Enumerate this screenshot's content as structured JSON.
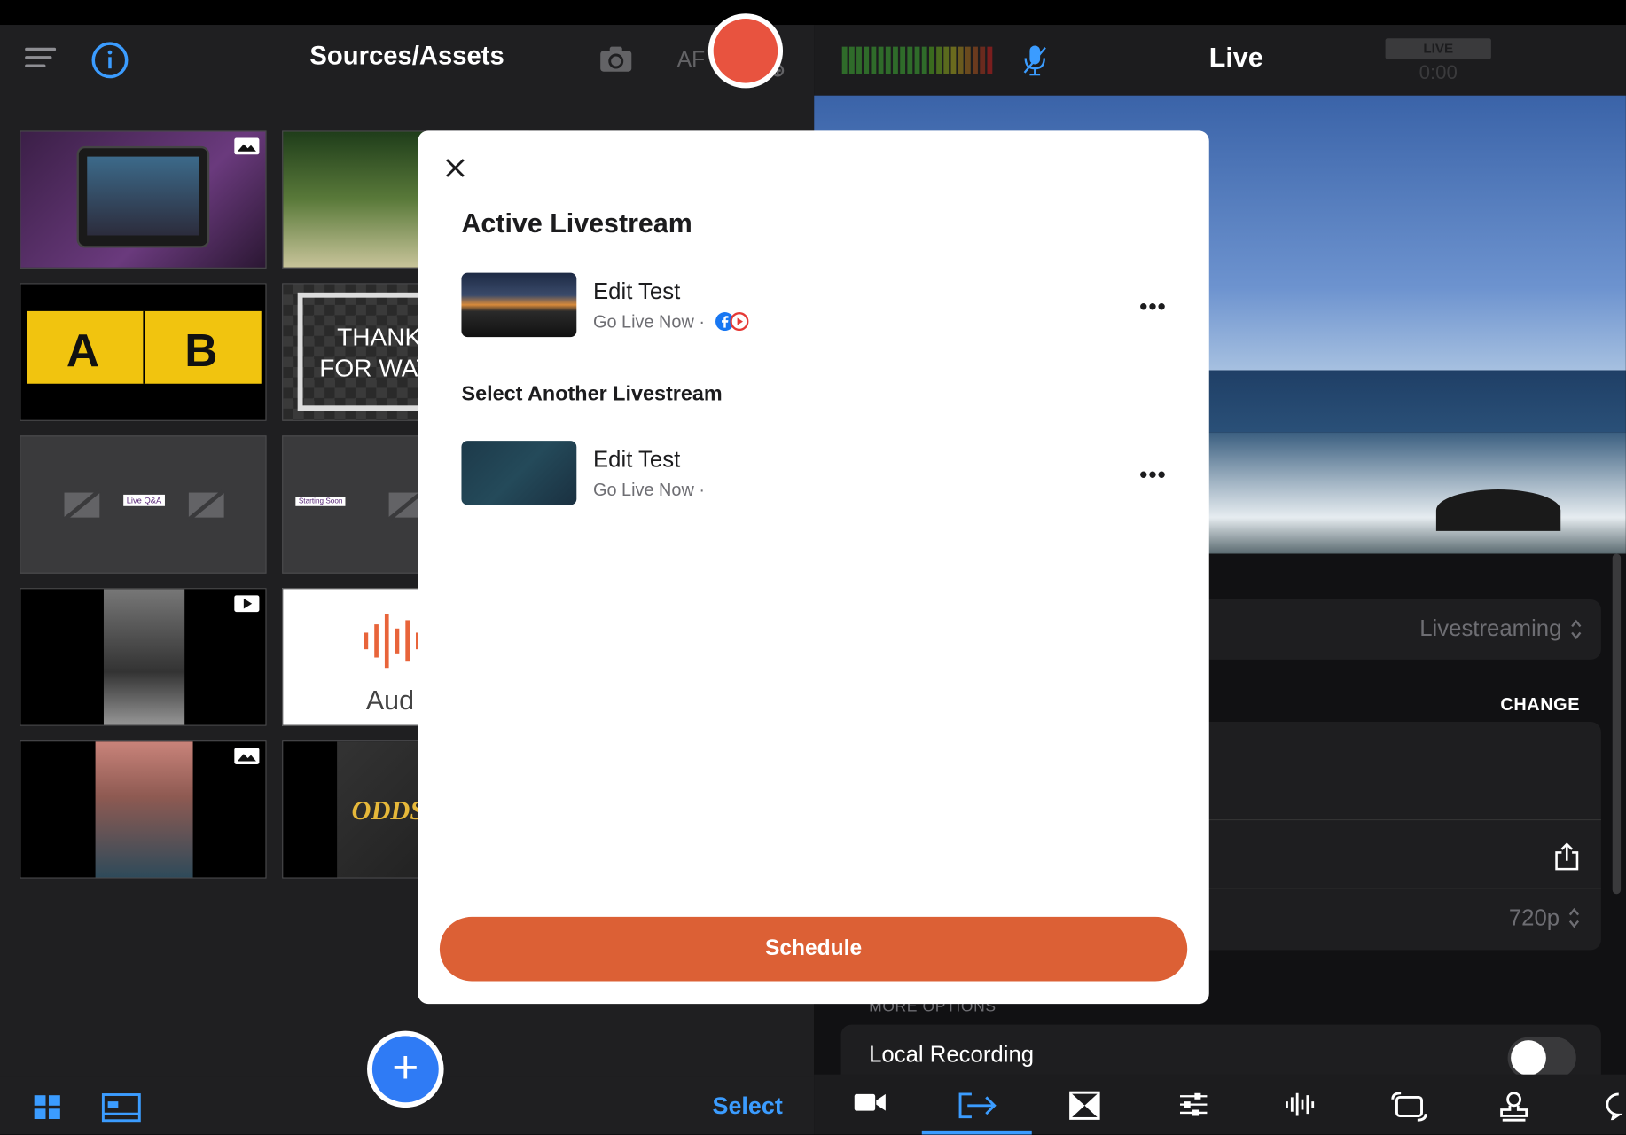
{
  "left_panel": {
    "title": "Sources/Assets",
    "af_label": "AF",
    "select_label": "Select",
    "thumbnails": {
      "t3_a": "A",
      "t3_b": "B",
      "t4_text1": "THANK",
      "t4_text2": "FOR WAT",
      "t5_label": "Live Q&A",
      "t6_label": "Starting Soon",
      "t8_label": "Aud",
      "t10_label": "ODDS"
    }
  },
  "right_panel": {
    "title": "Live",
    "live_badge": "LIVE",
    "timer": "0:00",
    "mode_value": "Livestreaming",
    "change_label": "CHANGE",
    "resolution_value": "720p",
    "more_options_label": "MORE OPTIONS",
    "local_recording_label": "Local Recording"
  },
  "modal": {
    "title": "Active Livestream",
    "active_item": {
      "name": "Edit Test",
      "sub": "Go Live Now ·"
    },
    "section_label": "Select Another Livestream",
    "other_item": {
      "name": "Edit Test",
      "sub": "Go Live Now ·"
    },
    "more_glyph": "•••",
    "schedule_label": "Schedule"
  },
  "colors": {
    "accent_blue": "#2f7bf5",
    "record_red": "#e8533f",
    "schedule_orange": "#dc6035"
  }
}
